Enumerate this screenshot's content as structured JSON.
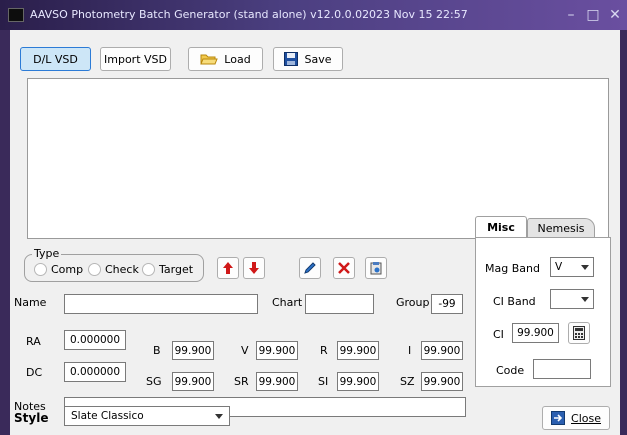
{
  "window": {
    "title": "AAVSO Photometry Batch Generator (stand alone)  v12.0.0.02023 Nov 15 22:57",
    "minimize_glyph": "–",
    "maximize_glyph": "□",
    "close_glyph": "✕"
  },
  "toolbar": {
    "dl_vsd_label": "D/L VSD",
    "import_vsd_label": "Import VSD",
    "load_label": "Load",
    "save_label": "Save"
  },
  "type_group": {
    "legend": "Type",
    "options": [
      "Comp",
      "Check",
      "Target"
    ]
  },
  "form": {
    "name_label": "Name",
    "name_value": "",
    "chart_label": "Chart",
    "chart_value": "",
    "group_label": "Group",
    "group_value": "-99",
    "ra_label": "RA",
    "ra_value": "0.000000",
    "dc_label": "DC",
    "dc_value": "0.000000",
    "b_label": "B",
    "b_value": "99.900",
    "v_label": "V",
    "v_value": "99.900",
    "r_label": "R",
    "r_value": "99.900",
    "i_label": "I",
    "i_value": "99.900",
    "sg_label": "SG",
    "sg_value": "99.900",
    "sr_label": "SR",
    "sr_value": "99.900",
    "si_label": "SI",
    "si_value": "99.900",
    "sz_label": "SZ",
    "sz_value": "99.900",
    "notes_label": "Notes",
    "notes_value": ""
  },
  "misc_panel": {
    "tabs": [
      "Misc",
      "Nemesis"
    ],
    "mag_band_label": "Mag Band",
    "mag_band_value": "V",
    "ci_band_label": "CI Band",
    "ci_band_value": "",
    "ci_label": "CI",
    "ci_value": "99.900",
    "code_label": "Code",
    "code_value": ""
  },
  "footer": {
    "style_label": "Style",
    "style_value": "Slate Classico",
    "close_label": "Close"
  },
  "colors": {
    "accent_red": "#e01010",
    "active_button": "#cde6f7"
  },
  "icons": [
    "app-icon",
    "folder-open-icon",
    "floppy-disk-icon",
    "up-arrow-icon",
    "down-arrow-icon",
    "pencil-icon",
    "delete-x-icon",
    "clipboard-icon",
    "calculator-icon",
    "exit-door-icon",
    "red-up-arrow-annotation"
  ]
}
